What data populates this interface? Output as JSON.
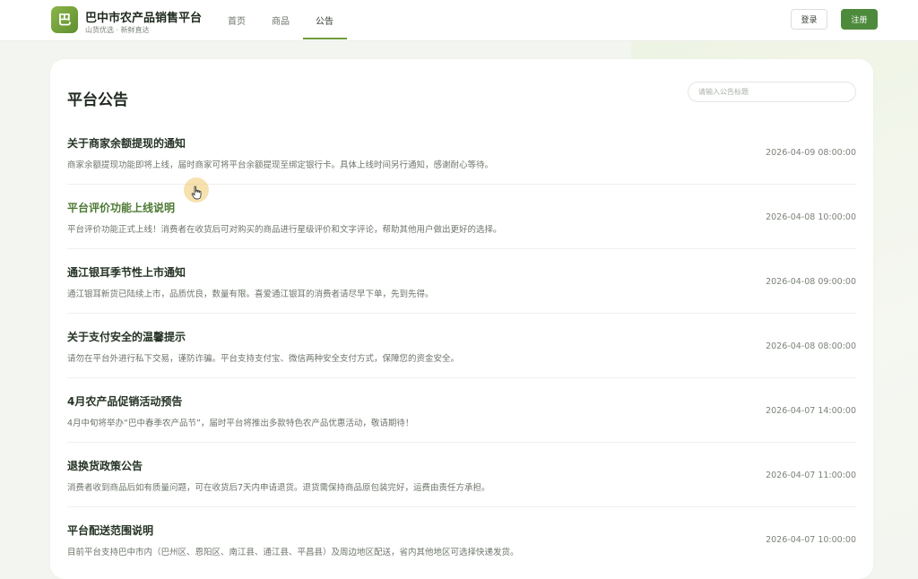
{
  "brand": {
    "logo_char": "巴",
    "title": "巴中市农产品销售平台",
    "subtitle": "山货优选 · 新鲜直达"
  },
  "nav": {
    "items": [
      {
        "label": "首页",
        "active": false
      },
      {
        "label": "商品",
        "active": false
      },
      {
        "label": "公告",
        "active": true
      }
    ]
  },
  "auth": {
    "login_label": "登录",
    "register_label": "注册"
  },
  "colors": {
    "accent_green": "#4e8a3c",
    "highlight_title": "#4d7a34"
  },
  "main": {
    "page_title": "平台公告",
    "search_placeholder": "请输入公告标题",
    "notices": [
      {
        "title": "关于商家余额提现的通知",
        "desc": "商家余额提现功能即将上线，届时商家可将平台余额提现至绑定银行卡。具体上线时间另行通知，感谢耐心等待。",
        "date": "2026-04-09 08:00:00"
      },
      {
        "title": "平台评价功能上线说明",
        "desc": "平台评价功能正式上线！消费者在收货后可对购买的商品进行星级评价和文字评论，帮助其他用户做出更好的选择。",
        "date": "2026-04-08 10:00:00"
      },
      {
        "title": "通江银耳季节性上市通知",
        "desc": "通江银耳新货已陆续上市，品质优良，数量有限。喜爱通江银耳的消费者请尽早下单，先到先得。",
        "date": "2026-04-08 09:00:00"
      },
      {
        "title": "关于支付安全的温馨提示",
        "desc": "请勿在平台外进行私下交易，谨防诈骗。平台支持支付宝、微信两种安全支付方式，保障您的资金安全。",
        "date": "2026-04-08 08:00:00"
      },
      {
        "title": "4月农产品促销活动预告",
        "desc": "4月中旬将举办“巴中春季农产品节”，届时平台将推出多款特色农产品优惠活动，敬请期待！",
        "date": "2026-04-07 14:00:00"
      },
      {
        "title": "退换货政策公告",
        "desc": "消费者收到商品后如有质量问题，可在收货后7天内申请退货。退货需保持商品原包装完好，运费由责任方承担。",
        "date": "2026-04-07 11:00:00"
      },
      {
        "title": "平台配送范围说明",
        "desc": "目前平台支持巴中市内（巴州区、恩阳区、南江县、通江县、平昌县）及周边地区配送，省内其他地区可选择快递发货。",
        "date": "2026-04-07 10:00:00"
      }
    ]
  },
  "cursor": {
    "icon": "hand-pointer-icon"
  }
}
